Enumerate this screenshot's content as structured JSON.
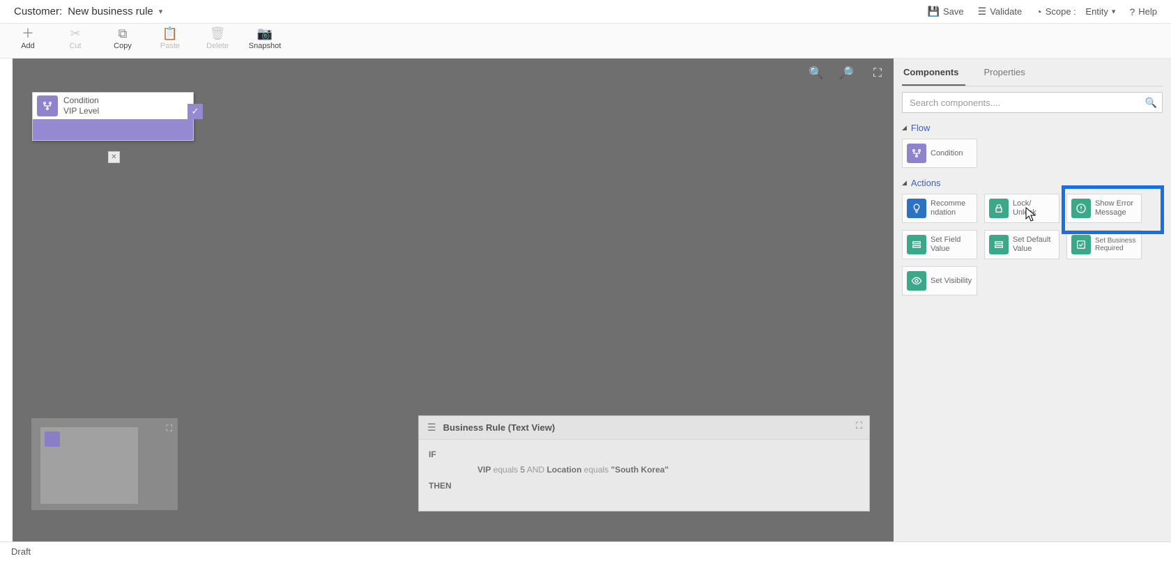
{
  "title": {
    "entity": "Customer:",
    "name": "New business rule"
  },
  "header_actions": {
    "save": "Save",
    "validate": "Validate",
    "scope_label": "Scope :",
    "scope_value": "Entity",
    "help": "Help"
  },
  "toolbar": {
    "add": "Add",
    "cut": "Cut",
    "copy": "Copy",
    "paste": "Paste",
    "delete": "Delete",
    "snapshot": "Snapshot"
  },
  "node": {
    "type": "Condition",
    "name": "VIP Level"
  },
  "textview": {
    "title": "Business Rule (Text View)",
    "if": "IF",
    "then": "THEN",
    "f1": "VIP",
    "op1": "equals",
    "v1": "5",
    "and": "AND",
    "f2": "Location",
    "op2": "equals",
    "v2": "\"South Korea\""
  },
  "side_tabs": {
    "components": "Components",
    "properties": "Properties"
  },
  "search_placeholder": "Search components....",
  "groups": {
    "flow": "Flow",
    "actions": "Actions"
  },
  "flow_cards": {
    "condition": "Condition"
  },
  "action_cards": {
    "recommend": "Recomme ndation",
    "lock": "Lock/ Unlock",
    "error": "Show Error Message",
    "setfield": "Set Field Value",
    "setdefault": "Set Default Value",
    "setrequired": "Set Business Required",
    "setvis": "Set Visibility"
  },
  "status": "Draft"
}
